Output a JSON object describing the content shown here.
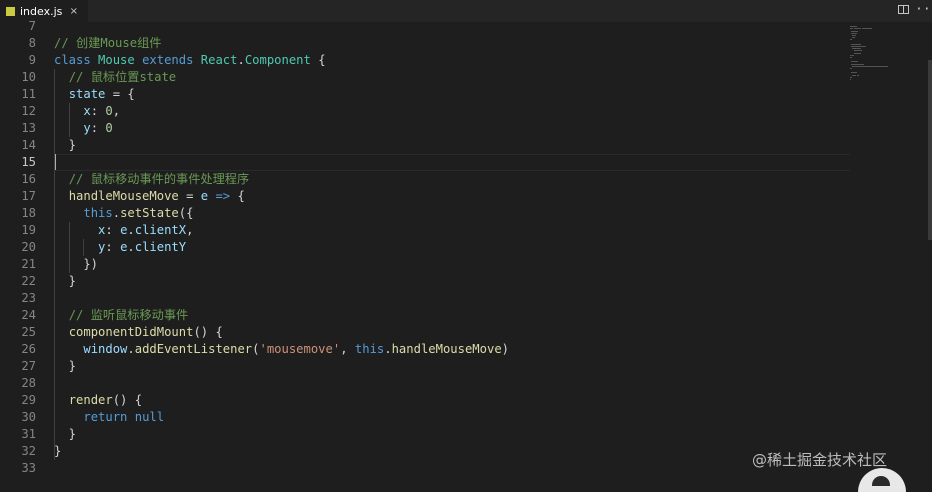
{
  "tab": {
    "filename": "index.js",
    "close_glyph": "×"
  },
  "toolbar": {
    "split_icon": "split-editor-icon",
    "more_glyph": "···"
  },
  "watermark": "@稀土掘金技术社区",
  "colors": {
    "background": "#1e1e1e",
    "keyword": "#569cd6",
    "class": "#4ec9b0",
    "function": "#dcdcaa",
    "variable": "#9cdcfe",
    "number": "#b5cea8",
    "string": "#ce9178",
    "comment": "#6a9955"
  },
  "lines": [
    {
      "n": "7",
      "t": []
    },
    {
      "n": "8",
      "t": [
        [
          "cmt",
          "// 创建Mouse组件"
        ]
      ]
    },
    {
      "n": "9",
      "t": [
        [
          "kw",
          "class"
        ],
        [
          "pun",
          " "
        ],
        [
          "cls",
          "Mouse"
        ],
        [
          "pun",
          " "
        ],
        [
          "kw",
          "extends"
        ],
        [
          "pun",
          " "
        ],
        [
          "cls",
          "React"
        ],
        [
          "pun",
          "."
        ],
        [
          "cls",
          "Component"
        ],
        [
          "pun",
          " {"
        ]
      ]
    },
    {
      "n": "10",
      "t": [
        [
          "pun",
          "  "
        ],
        [
          "cmt",
          "// 鼠标位置state"
        ]
      ]
    },
    {
      "n": "11",
      "t": [
        [
          "pun",
          "  "
        ],
        [
          "var",
          "state"
        ],
        [
          "pun",
          " = {"
        ]
      ]
    },
    {
      "n": "12",
      "t": [
        [
          "pun",
          "    "
        ],
        [
          "var",
          "x"
        ],
        [
          "pun",
          ": "
        ],
        [
          "num",
          "0"
        ],
        [
          "pun",
          ","
        ]
      ]
    },
    {
      "n": "13",
      "t": [
        [
          "pun",
          "    "
        ],
        [
          "var",
          "y"
        ],
        [
          "pun",
          ": "
        ],
        [
          "num",
          "0"
        ]
      ]
    },
    {
      "n": "14",
      "t": [
        [
          "pun",
          "  }"
        ]
      ]
    },
    {
      "n": "15",
      "t": [],
      "active": true
    },
    {
      "n": "16",
      "t": [
        [
          "pun",
          "  "
        ],
        [
          "cmt",
          "// 鼠标移动事件的事件处理程序"
        ]
      ]
    },
    {
      "n": "17",
      "t": [
        [
          "pun",
          "  "
        ],
        [
          "fn",
          "handleMouseMove"
        ],
        [
          "pun",
          " = "
        ],
        [
          "var",
          "e"
        ],
        [
          "pun",
          " "
        ],
        [
          "kw",
          "=>"
        ],
        [
          "pun",
          " {"
        ]
      ]
    },
    {
      "n": "18",
      "t": [
        [
          "pun",
          "    "
        ],
        [
          "kw",
          "this"
        ],
        [
          "pun",
          "."
        ],
        [
          "fn",
          "setState"
        ],
        [
          "pun",
          "({"
        ]
      ]
    },
    {
      "n": "19",
      "t": [
        [
          "pun",
          "      "
        ],
        [
          "var",
          "x"
        ],
        [
          "pun",
          ": "
        ],
        [
          "var",
          "e"
        ],
        [
          "pun",
          "."
        ],
        [
          "var",
          "clientX"
        ],
        [
          "pun",
          ","
        ]
      ]
    },
    {
      "n": "20",
      "t": [
        [
          "pun",
          "      "
        ],
        [
          "var",
          "y"
        ],
        [
          "pun",
          ": "
        ],
        [
          "var",
          "e"
        ],
        [
          "pun",
          "."
        ],
        [
          "var",
          "clientY"
        ]
      ]
    },
    {
      "n": "21",
      "t": [
        [
          "pun",
          "    })"
        ]
      ]
    },
    {
      "n": "22",
      "t": [
        [
          "pun",
          "  }"
        ]
      ]
    },
    {
      "n": "23",
      "t": []
    },
    {
      "n": "24",
      "t": [
        [
          "pun",
          "  "
        ],
        [
          "cmt",
          "// 监听鼠标移动事件"
        ]
      ]
    },
    {
      "n": "25",
      "t": [
        [
          "pun",
          "  "
        ],
        [
          "fn",
          "componentDidMount"
        ],
        [
          "pun",
          "() {"
        ]
      ]
    },
    {
      "n": "26",
      "t": [
        [
          "pun",
          "    "
        ],
        [
          "var",
          "window"
        ],
        [
          "pun",
          "."
        ],
        [
          "fn",
          "addEventListener"
        ],
        [
          "pun",
          "("
        ],
        [
          "str",
          "'mousemove'"
        ],
        [
          "pun",
          ", "
        ],
        [
          "kw",
          "this"
        ],
        [
          "pun",
          "."
        ],
        [
          "fn",
          "handleMouseMove"
        ],
        [
          "pun",
          ")"
        ]
      ]
    },
    {
      "n": "27",
      "t": [
        [
          "pun",
          "  }"
        ]
      ]
    },
    {
      "n": "28",
      "t": []
    },
    {
      "n": "29",
      "t": [
        [
          "pun",
          "  "
        ],
        [
          "fn",
          "render"
        ],
        [
          "pun",
          "() {"
        ]
      ]
    },
    {
      "n": "30",
      "t": [
        [
          "pun",
          "    "
        ],
        [
          "kw",
          "return"
        ],
        [
          "pun",
          " "
        ],
        [
          "kw",
          "null"
        ]
      ]
    },
    {
      "n": "31",
      "t": [
        [
          "pun",
          "  }"
        ]
      ]
    },
    {
      "n": "32",
      "t": [
        [
          "pun",
          "}"
        ]
      ]
    },
    {
      "n": "33",
      "t": []
    }
  ]
}
